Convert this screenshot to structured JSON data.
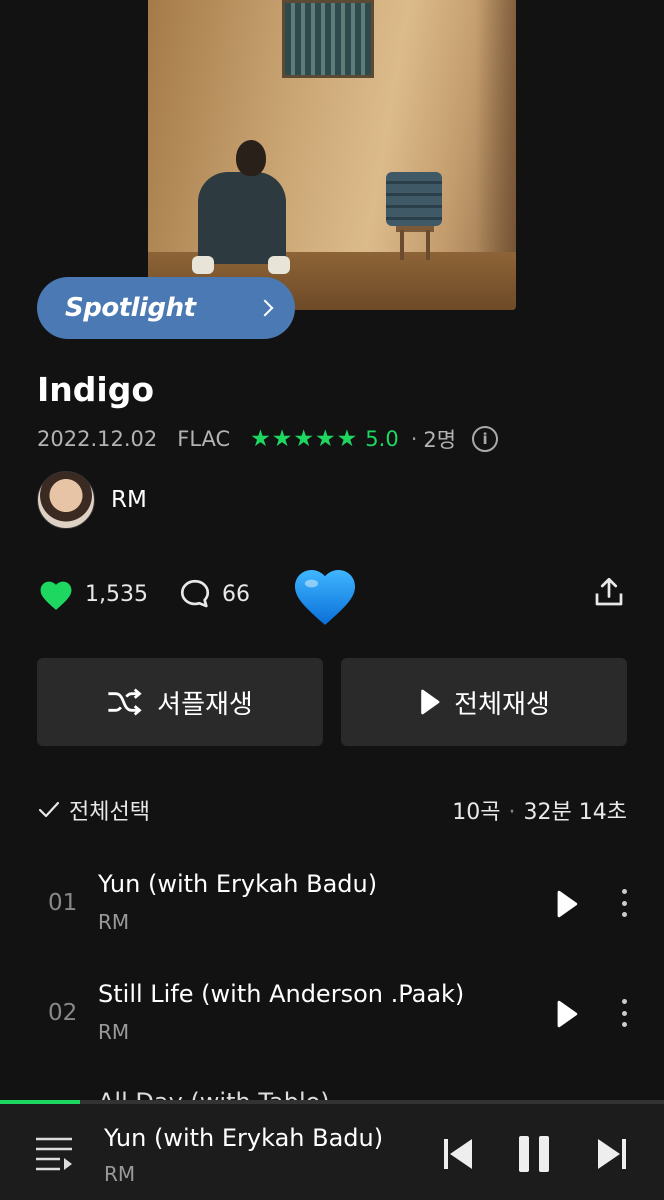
{
  "spotlight": {
    "label": "Spotlight"
  },
  "album": {
    "title": "Indigo",
    "release_date": "2022.12.02",
    "format": "FLAC",
    "rating_stars": 5,
    "rating": "5.0",
    "dot": "·",
    "raters": "2명"
  },
  "artist": {
    "name": "RM"
  },
  "stats": {
    "likes": "1,535",
    "comments": "66"
  },
  "buttons": {
    "shuffle": "셔플재생",
    "play_all": "전체재생"
  },
  "list_header": {
    "select_all": "전체선택",
    "track_count": "10곡",
    "sep": "·",
    "duration": "32분 14초"
  },
  "tracks": [
    {
      "num": "01",
      "title": "Yun (with Erykah Badu)",
      "artist": "RM"
    },
    {
      "num": "02",
      "title": "Still Life (with Anderson .Paak)",
      "artist": "RM"
    }
  ],
  "track3_peek": "All Day (with Tablo)",
  "now_playing": {
    "title": "Yun (with Erykah Badu)",
    "artist": "RM",
    "progress": 0.12
  },
  "colors": {
    "accent": "#1ed760",
    "spotlight": "#4a79b3",
    "background": "#121212"
  },
  "icons": {
    "like": "heart-icon",
    "comment": "comment-icon",
    "big_heart": "blue-heart-emoji",
    "share": "share-icon",
    "shuffle": "shuffle-icon",
    "play": "play-icon",
    "check": "check-icon",
    "more": "more-vertical-icon",
    "queue": "playlist-icon",
    "prev": "skip-previous-icon",
    "pause": "pause-icon",
    "next": "skip-next-icon",
    "info": "info-icon",
    "chevron": "chevron-right-icon"
  }
}
